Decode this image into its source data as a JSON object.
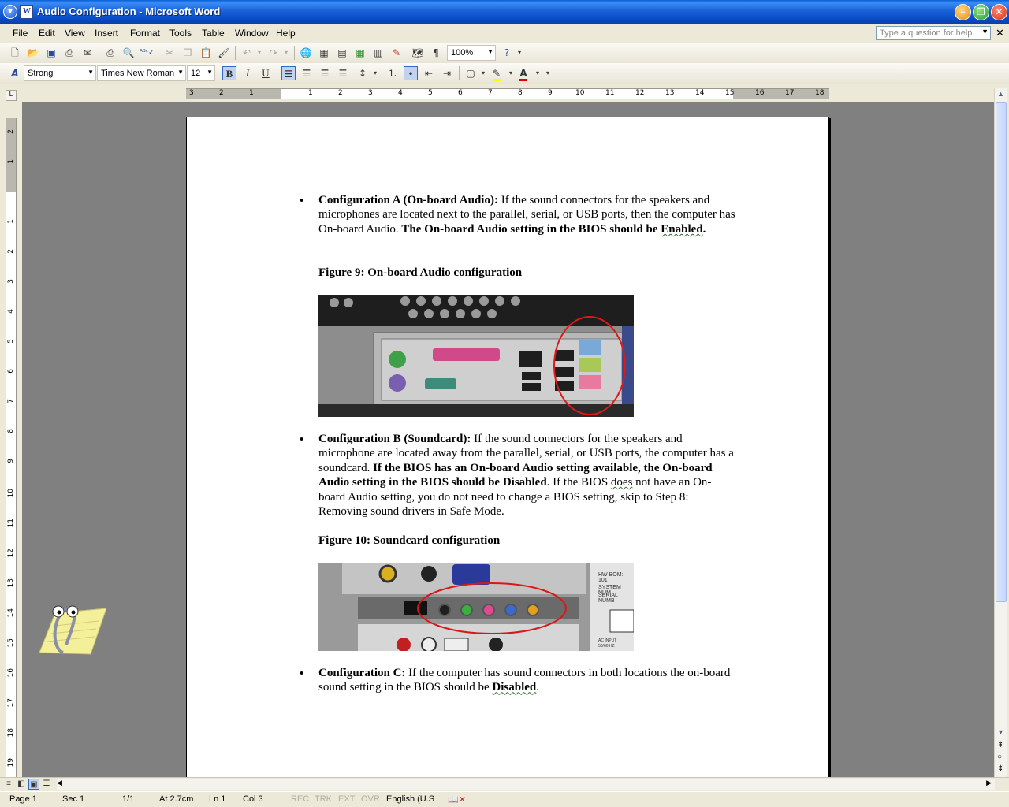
{
  "window": {
    "title": "Audio Configuration - Microsoft Word"
  },
  "menu": [
    "File",
    "Edit",
    "View",
    "Insert",
    "Format",
    "Tools",
    "Table",
    "Window",
    "Help"
  ],
  "help_box": {
    "placeholder": "Type a question for help"
  },
  "toolbar": {
    "zoom": "100%"
  },
  "format_bar": {
    "style": "Strong",
    "font": "Times New Roman",
    "size": "12"
  },
  "ruler": {
    "h_labels": [
      "3",
      "2",
      "1",
      "1",
      "2",
      "3",
      "4",
      "5",
      "6",
      "7",
      "8",
      "9",
      "10",
      "11",
      "12",
      "13",
      "14",
      "15",
      "16",
      "17",
      "18"
    ],
    "v_labels": [
      "2",
      "1",
      "1",
      "2",
      "3",
      "4",
      "5",
      "6",
      "7",
      "8",
      "9",
      "10",
      "11",
      "12",
      "13",
      "14",
      "15",
      "16",
      "17",
      "18",
      "19"
    ]
  },
  "document": {
    "config_a": {
      "lead": "Configuration A (On-board Audio):",
      "text1": " If the sound connectors for the speakers and microphones are located next to the parallel, serial, or USB ports, then the computer has On-board Audio. ",
      "bold_pre": "The On-board Audio setting in the BIOS should be ",
      "bold_word": "Enabled",
      "bold_post": "."
    },
    "figure9": "Figure 9: On-board Audio configuration",
    "config_b": {
      "lead": "Configuration B (Soundcard):",
      "text1": " If the sound connectors for the speakers and microphone are located away from the parallel, serial, or USB ports, the computer has a soundcard. ",
      "bold": "If the BIOS has an On-board Audio setting available, the On-board Audio setting in the BIOS should be Disabled",
      "text2_pre": ". If the BIOS ",
      "text2_squig": "does",
      "text2_post": " not have an On-board Audio setting, you do not need to change a BIOS setting, skip to Step 8: Removing sound drivers in Safe Mode."
    },
    "figure10": "Figure 10: Soundcard configuration",
    "config_c": {
      "lead": "Configuration C:",
      "text1": " If the computer has sound connectors in both locations the on-board sound setting in the BIOS should be ",
      "bold_word": "Disabled",
      "post": "."
    },
    "fig10_labels": {
      "l1": "HW BOM: 101",
      "l2": "SYSTEM NUM",
      "l3": "SERIAL NUMB",
      "l4": "AC INPUT",
      "l5": "50/60 HZ"
    }
  },
  "status": {
    "page": "Page  1",
    "sec": "Sec  1",
    "pages": "1/1",
    "at": "At  2.7cm",
    "ln": "Ln  1",
    "col": "Col  3",
    "rec": "REC",
    "trk": "TRK",
    "ext": "EXT",
    "ovr": "OVR",
    "lang": "English (U.S"
  }
}
